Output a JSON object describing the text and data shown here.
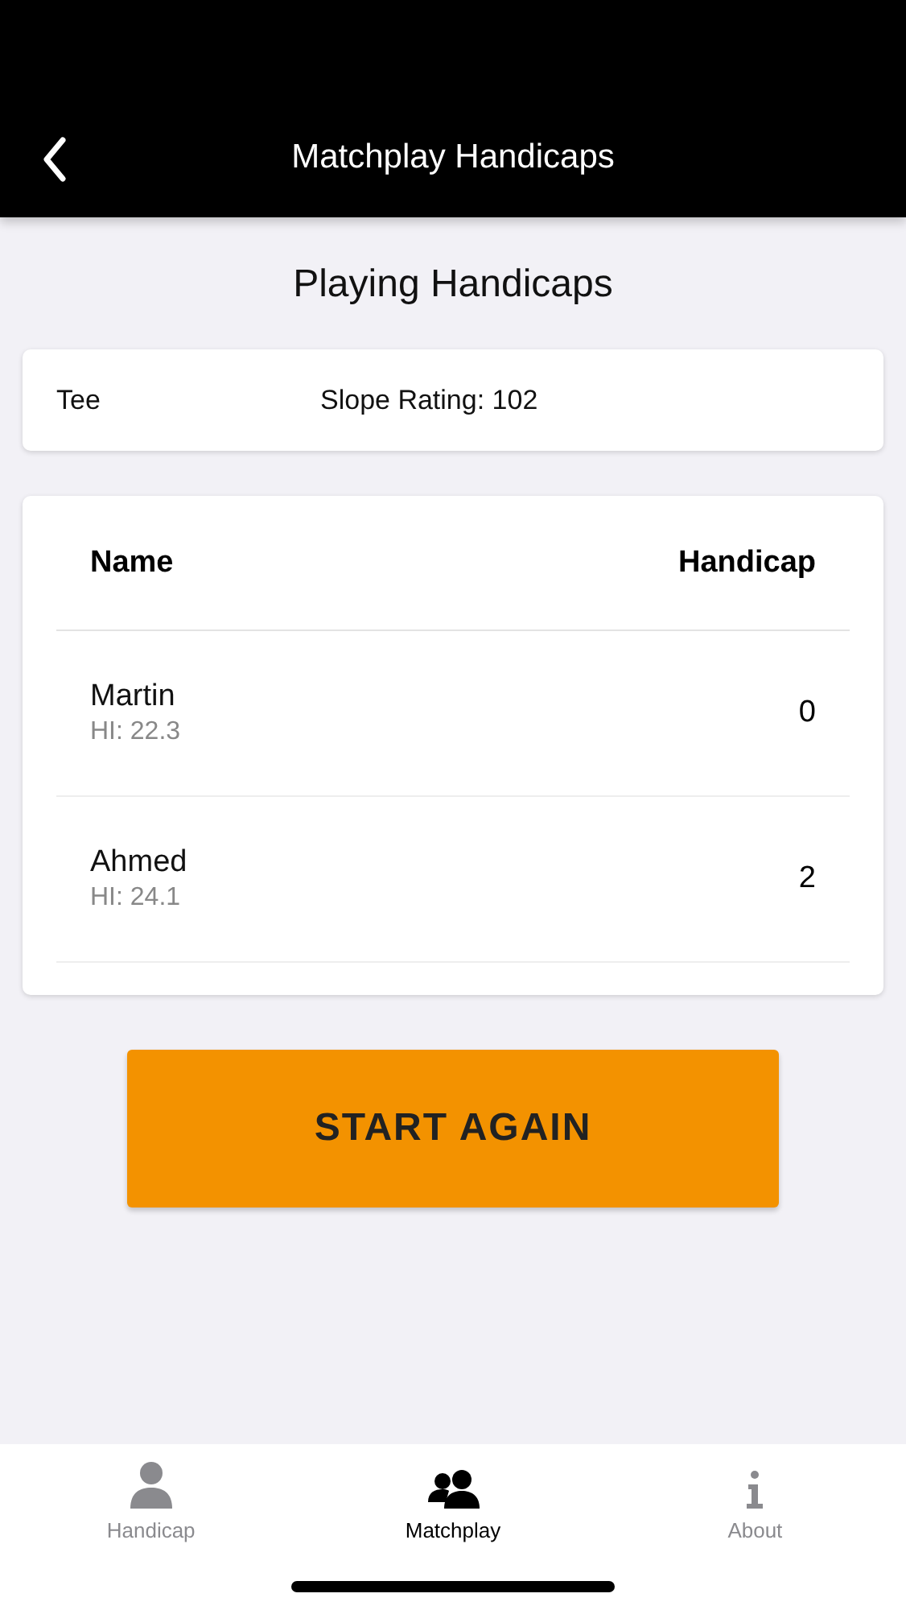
{
  "header": {
    "title": "Matchplay Handicaps"
  },
  "heading": "Playing Handicaps",
  "tee_card": {
    "tee": "Tee",
    "slope": "Slope Rating: 102"
  },
  "table": {
    "columns": [
      "Name",
      "Handicap"
    ],
    "rows": [
      {
        "name": "Martin",
        "index": "HI: 22.3",
        "handicap": "0"
      },
      {
        "name": "Ahmed",
        "index": "HI: 24.1",
        "handicap": "2"
      }
    ]
  },
  "button": "START AGAIN",
  "tabs": [
    {
      "kind": "person",
      "label": "Handicap",
      "selected": false
    },
    {
      "kind": "people",
      "label": "Matchplay",
      "selected": true
    },
    {
      "kind": "info",
      "label": "About",
      "selected": false
    }
  ]
}
